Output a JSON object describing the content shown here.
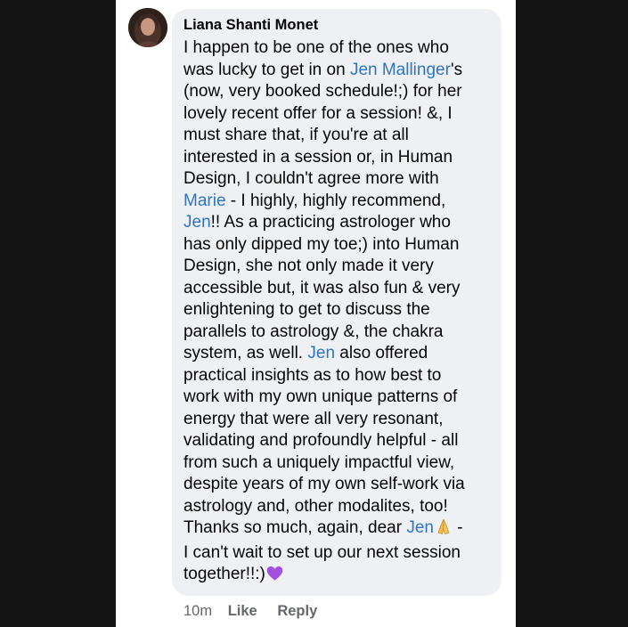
{
  "comment": {
    "author": "Liana Shanti Monet",
    "lines": [
      {
        "segments": [
          {
            "text": "I happen to be one of the ones who",
            "mention": false
          }
        ]
      },
      {
        "segments": [
          {
            "text": "was lucky to get in on ",
            "mention": false
          },
          {
            "text": "Jen Mallinger",
            "mention": true
          },
          {
            "text": "'s",
            "mention": false
          }
        ]
      },
      {
        "segments": [
          {
            "text": "(now, very booked schedule!;) for her",
            "mention": false
          }
        ]
      },
      {
        "segments": [
          {
            "text": "lovely recent offer for a session! &, I",
            "mention": false
          }
        ]
      },
      {
        "segments": [
          {
            "text": "must share that, if you're at all",
            "mention": false
          }
        ]
      },
      {
        "segments": [
          {
            "text": "interested in a session or, in Human",
            "mention": false
          }
        ]
      },
      {
        "segments": [
          {
            "text": "Design, I couldn't agree more with",
            "mention": false
          }
        ]
      },
      {
        "segments": [
          {
            "text": "Marie",
            "mention": true
          },
          {
            "text": " - I highly, highly recommend,",
            "mention": false
          }
        ]
      },
      {
        "segments": [
          {
            "text": "Jen",
            "mention": true
          },
          {
            "text": "!! As a practicing astrologer who",
            "mention": false
          }
        ]
      },
      {
        "segments": [
          {
            "text": "has only dipped my toe;) into Human",
            "mention": false
          }
        ]
      },
      {
        "segments": [
          {
            "text": "Design, she not only made it very",
            "mention": false
          }
        ]
      },
      {
        "segments": [
          {
            "text": "accessible but, it was also fun & very",
            "mention": false
          }
        ]
      },
      {
        "segments": [
          {
            "text": "enlightening to get to discuss the",
            "mention": false
          }
        ]
      },
      {
        "segments": [
          {
            "text": "parallels to astrology &, the chakra",
            "mention": false
          }
        ]
      },
      {
        "segments": [
          {
            "text": "system, as well. ",
            "mention": false
          },
          {
            "text": "Jen",
            "mention": true
          },
          {
            "text": " also offered",
            "mention": false
          }
        ]
      },
      {
        "segments": [
          {
            "text": "practical insights as to how best to",
            "mention": false
          }
        ]
      },
      {
        "segments": [
          {
            "text": "work with my own unique patterns of",
            "mention": false
          }
        ]
      },
      {
        "segments": [
          {
            "text": "energy that were all very resonant,",
            "mention": false
          }
        ]
      },
      {
        "segments": [
          {
            "text": "validating and profoundly helpful - all",
            "mention": false
          }
        ]
      },
      {
        "segments": [
          {
            "text": "from such a uniquely impactful view,",
            "mention": false
          }
        ]
      },
      {
        "segments": [
          {
            "text": "despite years of my own self-work via",
            "mention": false
          }
        ]
      },
      {
        "segments": [
          {
            "text": "astrology and, other modalites, too!",
            "mention": false
          }
        ]
      },
      {
        "segments": [
          {
            "text": "Thanks so much, again, dear ",
            "mention": false
          },
          {
            "text": "Jen",
            "mention": true
          },
          {
            "emoji": "folded-hands-icon"
          },
          {
            "text": " -",
            "mention": false
          }
        ]
      },
      {
        "segments": [
          {
            "text": "I can't wait to set up our next session",
            "mention": false
          }
        ]
      },
      {
        "segments": [
          {
            "text": "together!!:)",
            "mention": false
          },
          {
            "emoji": "purple-heart-icon"
          }
        ]
      }
    ],
    "colors": {
      "mention": "#2f74c0",
      "bubble": "#eef0f3",
      "meta": "#65676b"
    }
  },
  "actions": {
    "time": "10m",
    "like_label": "Like",
    "reply_label": "Reply"
  }
}
